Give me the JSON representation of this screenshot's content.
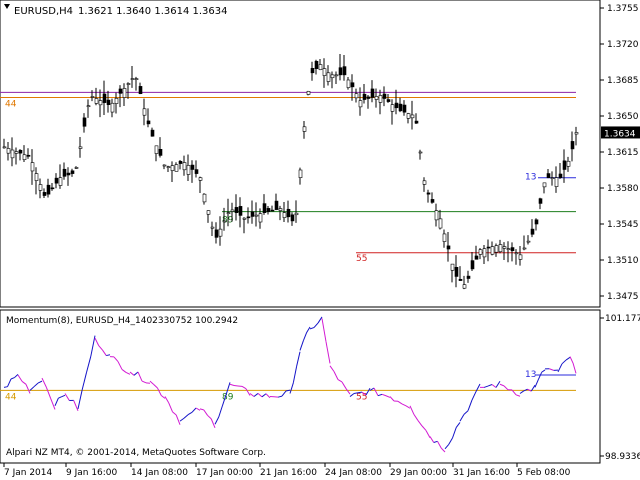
{
  "window": {
    "symbol_title": "EURUSD,H4",
    "ohlc": "1.3621 1.3640 1.3614 1.3634",
    "footer_copyright": "Alpari NZ MT4, © 2001-2014, MetaQuotes Software Corp."
  },
  "price_panel": {
    "axis_ticks": [
      "1.3755",
      "1.3720",
      "1.3685",
      "1.3650",
      "1.3615",
      "1.3580",
      "1.3545",
      "1.3510",
      "1.3475"
    ],
    "axis_tick_values": [
      1.3755,
      1.372,
      1.3685,
      1.365,
      1.3615,
      1.358,
      1.3545,
      1.351,
      1.3475
    ],
    "current_price": "1.3634",
    "current_price_value": 1.3634,
    "level_lines": [
      {
        "price": 1.3673,
        "color": "#8b22a8",
        "label": ""
      },
      {
        "price": 1.3668,
        "color": "#e07800",
        "label": "44"
      },
      {
        "price": 1.3557,
        "color": "#1e7e1e",
        "label": "89"
      },
      {
        "price": 1.3517,
        "color": "#d02020",
        "label": "55"
      }
    ],
    "short_line": {
      "price": 1.359,
      "color": "#2a2adc",
      "label": "13"
    }
  },
  "momentum_panel": {
    "title": "Momentum(8), EURUSD_H4_1402330752 100.2942",
    "axis_ticks": [
      "101.177",
      "98.9336"
    ],
    "axis_tick_values": [
      101.177,
      98.9336
    ],
    "level_line": {
      "value": 100.0,
      "color": "#d69a00",
      "label": "44"
    },
    "label_89": "89",
    "label_55": "55",
    "short_line": {
      "value": 100.25,
      "color": "#2a2adc",
      "label": "13"
    },
    "bull_color": "#1414c8",
    "bear_color": "#d21ad2"
  },
  "time_axis": {
    "labels": [
      "7 Jan 2014",
      "9 Jan 16:00",
      "14 Jan 08:00",
      "17 Jan 00:00",
      "21 Jan 16:00",
      "24 Jan 08:00",
      "29 Jan 00:00",
      "31 Jan 16:00",
      "5 Feb 08:00"
    ]
  },
  "colors": {
    "bar": "#000000",
    "background": "#ffffff",
    "axis": "#000000"
  }
}
